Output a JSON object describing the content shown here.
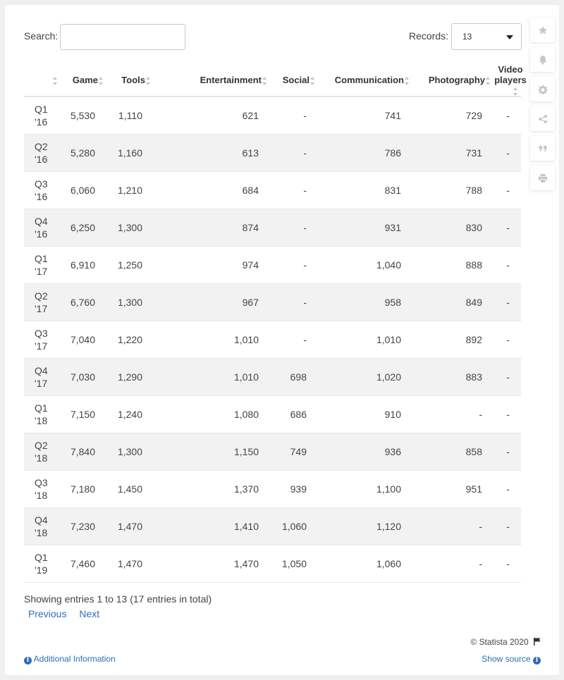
{
  "search": {
    "label": "Search:",
    "value": ""
  },
  "records": {
    "label": "Records:",
    "value": "13"
  },
  "table": {
    "columns": [
      "",
      "Game",
      "Tools",
      "Entertainment",
      "Social",
      "Communication",
      "Photography",
      "Video players"
    ],
    "rows": [
      [
        "Q1 '16",
        "5,530",
        "1,110",
        "621",
        "-",
        "741",
        "729",
        "-"
      ],
      [
        "Q2 '16",
        "5,280",
        "1,160",
        "613",
        "-",
        "786",
        "731",
        "-"
      ],
      [
        "Q3 '16",
        "6,060",
        "1,210",
        "684",
        "-",
        "831",
        "788",
        "-"
      ],
      [
        "Q4 '16",
        "6,250",
        "1,300",
        "874",
        "-",
        "931",
        "830",
        "-"
      ],
      [
        "Q1 '17",
        "6,910",
        "1,250",
        "974",
        "-",
        "1,040",
        "888",
        "-"
      ],
      [
        "Q2 '17",
        "6,760",
        "1,300",
        "967",
        "-",
        "958",
        "849",
        "-"
      ],
      [
        "Q3 '17",
        "7,040",
        "1,220",
        "1,010",
        "-",
        "1,010",
        "892",
        "-"
      ],
      [
        "Q4 '17",
        "7,030",
        "1,290",
        "1,010",
        "698",
        "1,020",
        "883",
        "-"
      ],
      [
        "Q1 '18",
        "7,150",
        "1,240",
        "1,080",
        "686",
        "910",
        "-",
        "-"
      ],
      [
        "Q2 '18",
        "7,840",
        "1,300",
        "1,150",
        "749",
        "936",
        "858",
        "-"
      ],
      [
        "Q3 '18",
        "7,180",
        "1,450",
        "1,370",
        "939",
        "1,100",
        "951",
        "-"
      ],
      [
        "Q4 '18",
        "7,230",
        "1,470",
        "1,410",
        "1,060",
        "1,120",
        "-",
        "-"
      ],
      [
        "Q1 '19",
        "7,460",
        "1,470",
        "1,470",
        "1,050",
        "1,060",
        "-",
        "-"
      ]
    ]
  },
  "footer": {
    "showing": "Showing entries 1 to 13 (17 entries in total)",
    "previous": "Previous",
    "next": "Next",
    "copyright": "© Statista 2020",
    "additional_info": "Additional Information",
    "show_source": "Show source"
  },
  "sidebar_icons": [
    "star-icon",
    "bell-icon",
    "gear-icon",
    "share-icon",
    "quote-icon",
    "print-icon"
  ],
  "colors": {
    "link": "#2f6db5",
    "stripe": "#f2f2f2",
    "icon": "#c7c7c7"
  }
}
